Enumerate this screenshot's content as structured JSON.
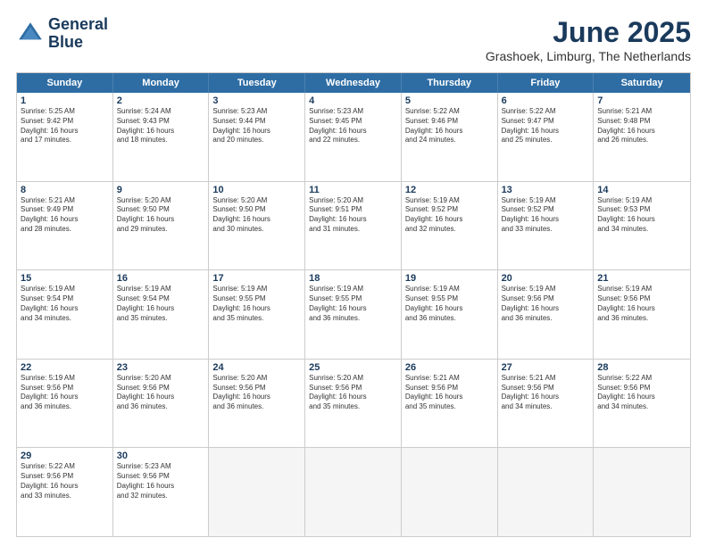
{
  "header": {
    "logo_line1": "General",
    "logo_line2": "Blue",
    "month": "June 2025",
    "location": "Grashoek, Limburg, The Netherlands"
  },
  "weekdays": [
    "Sunday",
    "Monday",
    "Tuesday",
    "Wednesday",
    "Thursday",
    "Friday",
    "Saturday"
  ],
  "rows": [
    [
      {
        "day": "1",
        "lines": [
          "Sunrise: 5:25 AM",
          "Sunset: 9:42 PM",
          "Daylight: 16 hours",
          "and 17 minutes."
        ]
      },
      {
        "day": "2",
        "lines": [
          "Sunrise: 5:24 AM",
          "Sunset: 9:43 PM",
          "Daylight: 16 hours",
          "and 18 minutes."
        ]
      },
      {
        "day": "3",
        "lines": [
          "Sunrise: 5:23 AM",
          "Sunset: 9:44 PM",
          "Daylight: 16 hours",
          "and 20 minutes."
        ]
      },
      {
        "day": "4",
        "lines": [
          "Sunrise: 5:23 AM",
          "Sunset: 9:45 PM",
          "Daylight: 16 hours",
          "and 22 minutes."
        ]
      },
      {
        "day": "5",
        "lines": [
          "Sunrise: 5:22 AM",
          "Sunset: 9:46 PM",
          "Daylight: 16 hours",
          "and 24 minutes."
        ]
      },
      {
        "day": "6",
        "lines": [
          "Sunrise: 5:22 AM",
          "Sunset: 9:47 PM",
          "Daylight: 16 hours",
          "and 25 minutes."
        ]
      },
      {
        "day": "7",
        "lines": [
          "Sunrise: 5:21 AM",
          "Sunset: 9:48 PM",
          "Daylight: 16 hours",
          "and 26 minutes."
        ]
      }
    ],
    [
      {
        "day": "8",
        "lines": [
          "Sunrise: 5:21 AM",
          "Sunset: 9:49 PM",
          "Daylight: 16 hours",
          "and 28 minutes."
        ]
      },
      {
        "day": "9",
        "lines": [
          "Sunrise: 5:20 AM",
          "Sunset: 9:50 PM",
          "Daylight: 16 hours",
          "and 29 minutes."
        ]
      },
      {
        "day": "10",
        "lines": [
          "Sunrise: 5:20 AM",
          "Sunset: 9:50 PM",
          "Daylight: 16 hours",
          "and 30 minutes."
        ]
      },
      {
        "day": "11",
        "lines": [
          "Sunrise: 5:20 AM",
          "Sunset: 9:51 PM",
          "Daylight: 16 hours",
          "and 31 minutes."
        ]
      },
      {
        "day": "12",
        "lines": [
          "Sunrise: 5:19 AM",
          "Sunset: 9:52 PM",
          "Daylight: 16 hours",
          "and 32 minutes."
        ]
      },
      {
        "day": "13",
        "lines": [
          "Sunrise: 5:19 AM",
          "Sunset: 9:52 PM",
          "Daylight: 16 hours",
          "and 33 minutes."
        ]
      },
      {
        "day": "14",
        "lines": [
          "Sunrise: 5:19 AM",
          "Sunset: 9:53 PM",
          "Daylight: 16 hours",
          "and 34 minutes."
        ]
      }
    ],
    [
      {
        "day": "15",
        "lines": [
          "Sunrise: 5:19 AM",
          "Sunset: 9:54 PM",
          "Daylight: 16 hours",
          "and 34 minutes."
        ]
      },
      {
        "day": "16",
        "lines": [
          "Sunrise: 5:19 AM",
          "Sunset: 9:54 PM",
          "Daylight: 16 hours",
          "and 35 minutes."
        ]
      },
      {
        "day": "17",
        "lines": [
          "Sunrise: 5:19 AM",
          "Sunset: 9:55 PM",
          "Daylight: 16 hours",
          "and 35 minutes."
        ]
      },
      {
        "day": "18",
        "lines": [
          "Sunrise: 5:19 AM",
          "Sunset: 9:55 PM",
          "Daylight: 16 hours",
          "and 36 minutes."
        ]
      },
      {
        "day": "19",
        "lines": [
          "Sunrise: 5:19 AM",
          "Sunset: 9:55 PM",
          "Daylight: 16 hours",
          "and 36 minutes."
        ]
      },
      {
        "day": "20",
        "lines": [
          "Sunrise: 5:19 AM",
          "Sunset: 9:56 PM",
          "Daylight: 16 hours",
          "and 36 minutes."
        ]
      },
      {
        "day": "21",
        "lines": [
          "Sunrise: 5:19 AM",
          "Sunset: 9:56 PM",
          "Daylight: 16 hours",
          "and 36 minutes."
        ]
      }
    ],
    [
      {
        "day": "22",
        "lines": [
          "Sunrise: 5:19 AM",
          "Sunset: 9:56 PM",
          "Daylight: 16 hours",
          "and 36 minutes."
        ]
      },
      {
        "day": "23",
        "lines": [
          "Sunrise: 5:20 AM",
          "Sunset: 9:56 PM",
          "Daylight: 16 hours",
          "and 36 minutes."
        ]
      },
      {
        "day": "24",
        "lines": [
          "Sunrise: 5:20 AM",
          "Sunset: 9:56 PM",
          "Daylight: 16 hours",
          "and 36 minutes."
        ]
      },
      {
        "day": "25",
        "lines": [
          "Sunrise: 5:20 AM",
          "Sunset: 9:56 PM",
          "Daylight: 16 hours",
          "and 35 minutes."
        ]
      },
      {
        "day": "26",
        "lines": [
          "Sunrise: 5:21 AM",
          "Sunset: 9:56 PM",
          "Daylight: 16 hours",
          "and 35 minutes."
        ]
      },
      {
        "day": "27",
        "lines": [
          "Sunrise: 5:21 AM",
          "Sunset: 9:56 PM",
          "Daylight: 16 hours",
          "and 34 minutes."
        ]
      },
      {
        "day": "28",
        "lines": [
          "Sunrise: 5:22 AM",
          "Sunset: 9:56 PM",
          "Daylight: 16 hours",
          "and 34 minutes."
        ]
      }
    ],
    [
      {
        "day": "29",
        "lines": [
          "Sunrise: 5:22 AM",
          "Sunset: 9:56 PM",
          "Daylight: 16 hours",
          "and 33 minutes."
        ]
      },
      {
        "day": "30",
        "lines": [
          "Sunrise: 5:23 AM",
          "Sunset: 9:56 PM",
          "Daylight: 16 hours",
          "and 32 minutes."
        ]
      },
      {
        "day": "",
        "lines": []
      },
      {
        "day": "",
        "lines": []
      },
      {
        "day": "",
        "lines": []
      },
      {
        "day": "",
        "lines": []
      },
      {
        "day": "",
        "lines": []
      }
    ]
  ]
}
